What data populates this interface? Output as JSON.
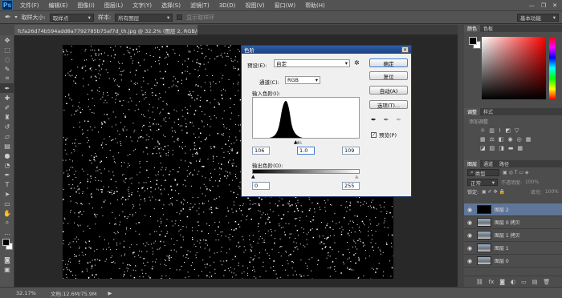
{
  "app": {
    "logo": "Ps",
    "menu": [
      "文件(F)",
      "编辑(E)",
      "图像(I)",
      "图层(L)",
      "文字(Y)",
      "选择(S)",
      "滤镜(T)",
      "3D(D)",
      "视图(V)",
      "窗口(W)",
      "帮助(H)"
    ],
    "window_buttons": [
      "—",
      "❐",
      "✕"
    ]
  },
  "options": {
    "sample_size_label": "取样大小:",
    "sample_size_value": "取样点",
    "sample_label": "样本:",
    "sample_value": "所有图层",
    "show_ring_label": "显示取样环",
    "workspace": "基本功能"
  },
  "document": {
    "tab_title": "fcfa26d74b594add8a7792785b75af7d_th.jpg @ 32.2% (图层 2, RGB/8#) *",
    "close": "×"
  },
  "status": {
    "zoom": "32.17%",
    "doc_size": "文档:12.6M/75.9M"
  },
  "levels_dialog": {
    "title": "色阶",
    "preset_label": "预设(E):",
    "preset_value": "自定",
    "channel_label": "通道(C):",
    "channel_value": "RGB",
    "input_levels_label": "输入色阶(I):",
    "input_black": "106",
    "input_gamma": "1.0",
    "input_white": "109",
    "output_levels_label": "输出色阶(O):",
    "output_black": "0",
    "output_white": "255",
    "buttons": {
      "ok": "确定",
      "reset": "复位",
      "auto": "自动(A)",
      "options": "选项(T)..."
    },
    "preview_label": "预览(P)",
    "preview_checked": true
  },
  "panels": {
    "color_tabs": [
      "颜色",
      "色板"
    ],
    "adjust_tabs": [
      "调整",
      "样式"
    ],
    "adjust_hint": "添加调整",
    "layers_tabs": [
      "图层",
      "通道",
      "路径"
    ],
    "layer_filter": "类型",
    "blend_mode": "正常",
    "opacity_label": "不透明度:",
    "opacity_value": "100%",
    "lock_label": "锁定:",
    "fill_label": "填充:",
    "fill_value": "100%",
    "layers": [
      {
        "name": "图层 2",
        "selected": true
      },
      {
        "name": "图层 0 拷贝",
        "selected": false
      },
      {
        "name": "图层 1 拷贝",
        "selected": false
      },
      {
        "name": "图层 1",
        "selected": false
      },
      {
        "name": "图层 0",
        "selected": false
      }
    ]
  },
  "colors": {
    "accent": "#1b3f7e",
    "layer_selected": "#5f7699"
  }
}
